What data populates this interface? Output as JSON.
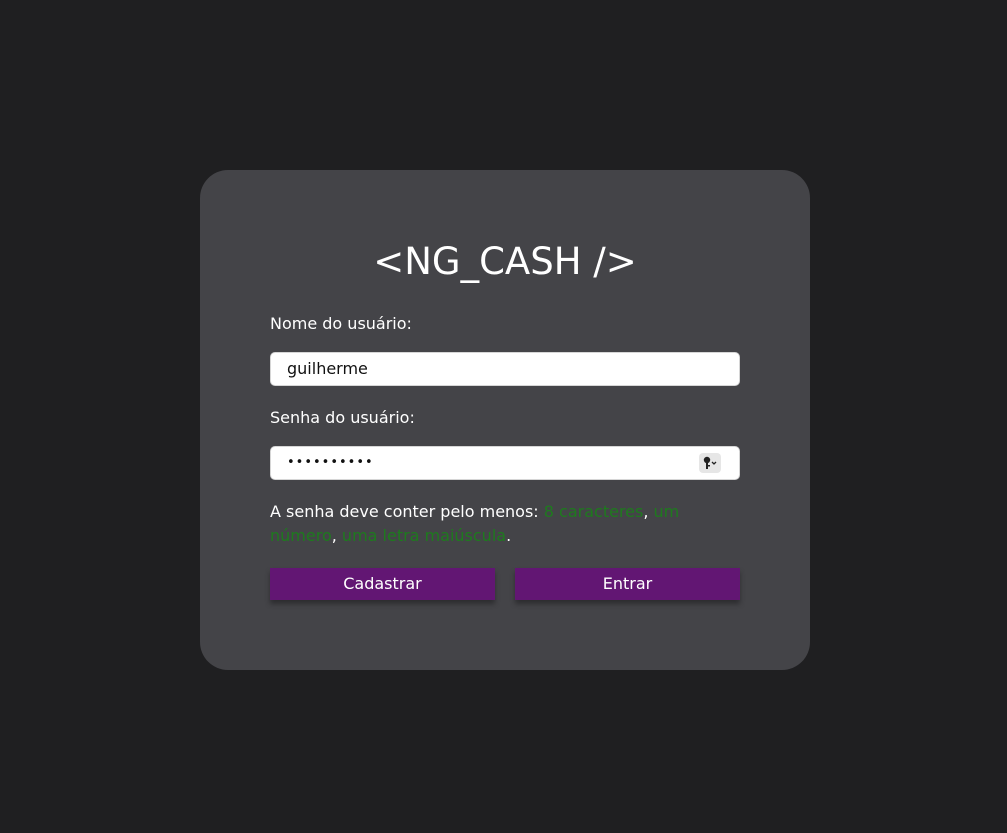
{
  "colors": {
    "page_background": "#1f1f21",
    "card_background": "#444448",
    "button": "#621673",
    "requirement_ok": "#1e7a1e"
  },
  "login": {
    "logo": "<NG_CASH />",
    "username_label": "Nome do usuário:",
    "username_value": "guilherme",
    "password_label": "Senha do usuário:",
    "password_value": "••••••••••",
    "password_manager_icon": "key-icon",
    "requirements": {
      "intro": "A senha deve conter pelo menos: ",
      "items": [
        "8 caracteres",
        "um número",
        "uma letra maiúscula"
      ],
      "sep1": ", ",
      "sep2": ",",
      "end": "."
    },
    "register_label": "Cadastrar",
    "enter_label": "Entrar"
  }
}
